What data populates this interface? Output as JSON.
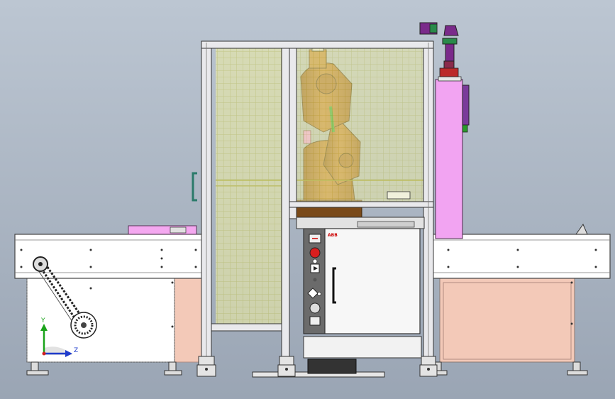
{
  "viewport": {
    "background_top": "#b9c3cf",
    "background_bottom": "#9ba6b5"
  },
  "colors": {
    "robot": "#b86e1e",
    "guard_mesh": "#e8e890",
    "cabinet_body": "#f6f6f6",
    "side_panel": "#f3c8b8",
    "pendant_box": "#f09cf0",
    "frame": "#e8e8ea",
    "conveyor": "#ffffff",
    "axis_y": "#1aa31a",
    "axis_z": "#1f3ccc",
    "axis_origin": "#d02020"
  },
  "controller": {
    "brand_text": "ABB"
  },
  "triad": {
    "y_label": "Y",
    "z_label": "Z"
  },
  "icons": [
    "emergency-stop-icon",
    "cabinet-handle-icon",
    "mode-switch-icon",
    "power-switch-icon"
  ]
}
